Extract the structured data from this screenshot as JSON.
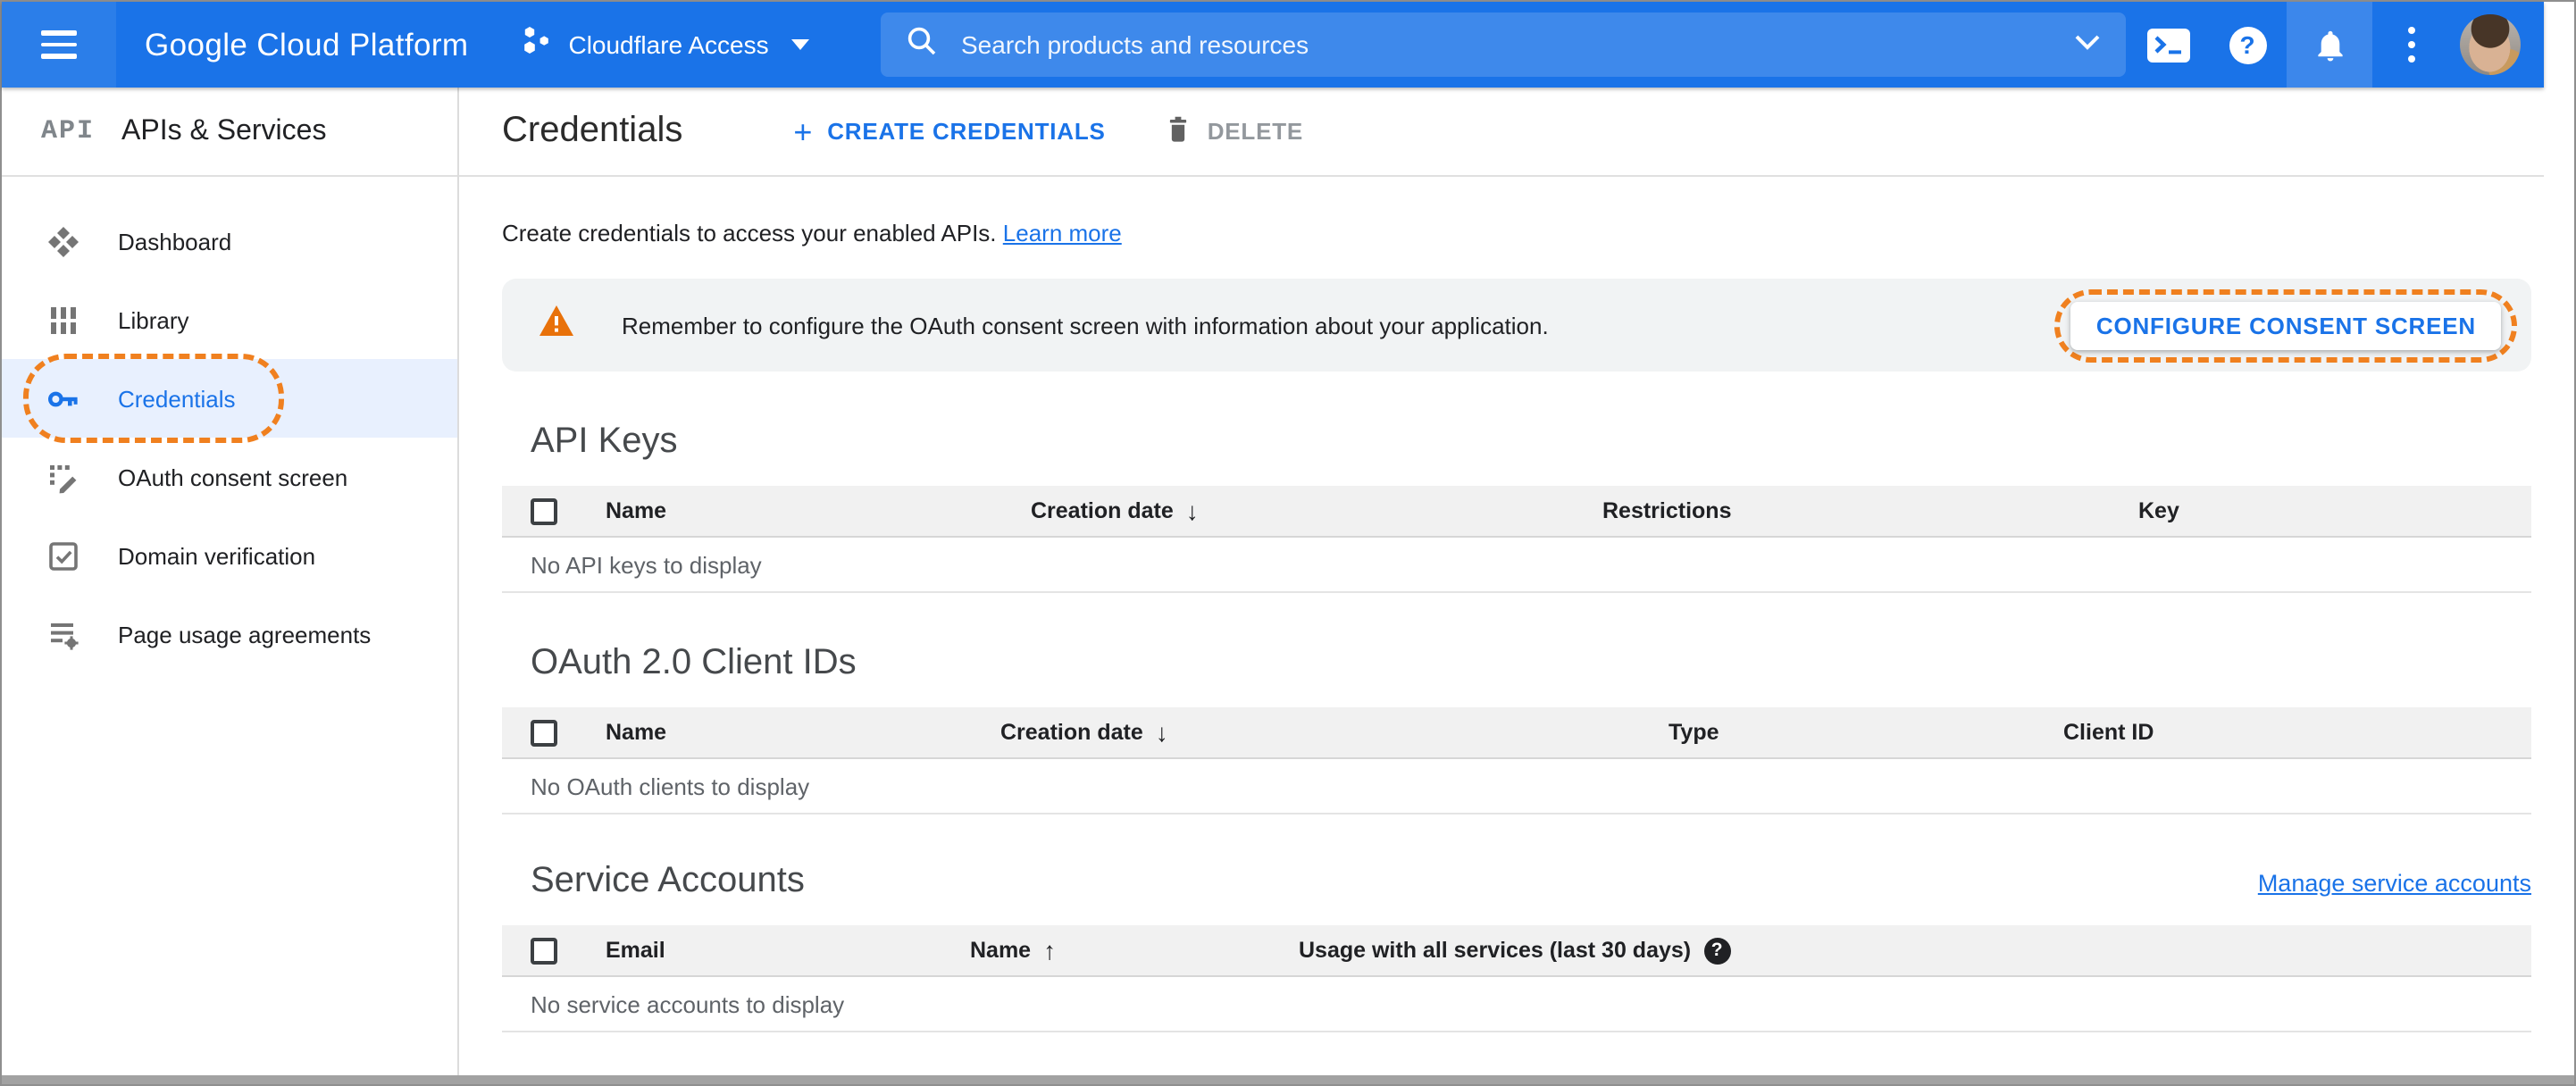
{
  "topbar": {
    "product_name": "Google Cloud Platform",
    "project_name": "Cloudflare Access",
    "search_placeholder": "Search products and resources"
  },
  "sidebar": {
    "logo_text": "API",
    "title": "APIs & Services",
    "items": [
      {
        "label": "Dashboard"
      },
      {
        "label": "Library"
      },
      {
        "label": "Credentials"
      },
      {
        "label": "OAuth consent screen"
      },
      {
        "label": "Domain verification"
      },
      {
        "label": "Page usage agreements"
      }
    ]
  },
  "toolbar": {
    "page_title": "Credentials",
    "create_label": "CREATE CREDENTIALS",
    "delete_label": "DELETE"
  },
  "content": {
    "intro_text": "Create credentials to access your enabled APIs.",
    "learn_more_label": "Learn more",
    "banner_text": "Remember to configure the OAuth consent screen with information about your application.",
    "banner_button_label": "CONFIGURE CONSENT SCREEN",
    "api_keys": {
      "heading": "API Keys",
      "columns": [
        "Name",
        "Creation date",
        "Restrictions",
        "Key"
      ],
      "sort_column": "Creation date",
      "sort_direction": "desc",
      "empty_text": "No API keys to display"
    },
    "oauth_clients": {
      "heading": "OAuth 2.0 Client IDs",
      "columns": [
        "Name",
        "Creation date",
        "Type",
        "Client ID"
      ],
      "sort_column": "Creation date",
      "sort_direction": "desc",
      "empty_text": "No OAuth clients to display"
    },
    "service_accounts": {
      "heading": "Service Accounts",
      "manage_link_label": "Manage service accounts",
      "columns": [
        "Email",
        "Name",
        "Usage with all services (last 30 days)"
      ],
      "sort_column": "Name",
      "sort_direction": "asc",
      "empty_text": "No service accounts to display"
    }
  },
  "icons": {
    "sort_desc_glyph": "↓",
    "sort_asc_glyph": "↑",
    "help_glyph": "?",
    "plus_glyph": "+"
  },
  "colors": {
    "header_blue": "#1a73e8",
    "link_blue": "#1a73e8",
    "active_item_bg": "#e8f0fe",
    "annotation_orange": "#f0801f",
    "warning_orange": "#e8710a",
    "banner_bg": "#f1f3f4"
  }
}
